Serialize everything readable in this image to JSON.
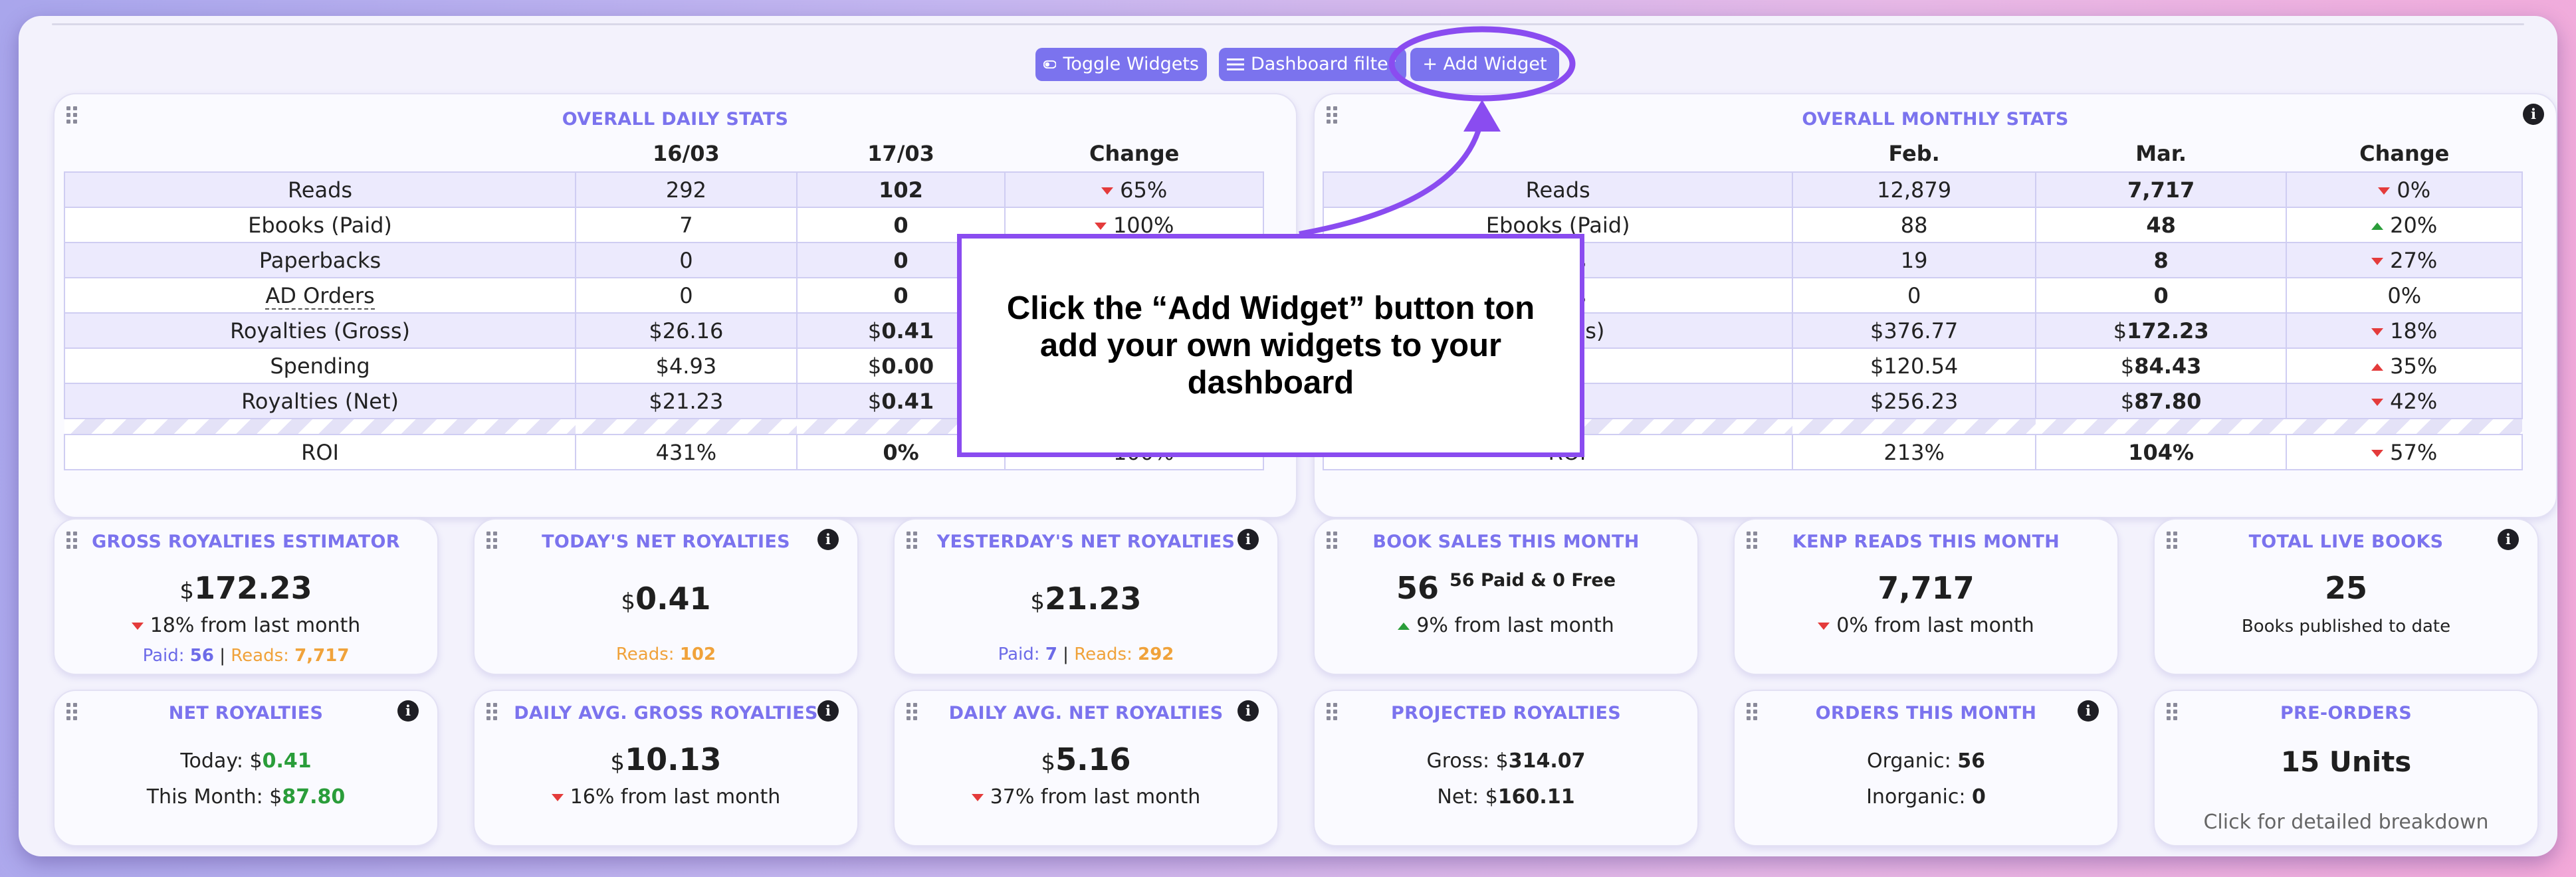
{
  "toolbar": {
    "toggle_widgets": "Toggle Widgets",
    "dashboard_filter": "Dashboard filter",
    "add_widget": "+ Add Widget"
  },
  "daily": {
    "title": "OVERALL DAILY STATS",
    "headers": [
      "",
      "16/03",
      "17/03",
      "Change"
    ],
    "rows": [
      {
        "label": "Reads",
        "a": "292",
        "b": "102",
        "change": "65%",
        "dir": "down"
      },
      {
        "label": "Ebooks (Paid)",
        "a": "7",
        "b": "0",
        "change": "100%",
        "dir": "down"
      },
      {
        "label": "Paperbacks",
        "a": "0",
        "b": "0",
        "change": "",
        "dir": ""
      },
      {
        "label": "AD Orders",
        "a": "0",
        "b": "0",
        "change": "",
        "dir": ""
      },
      {
        "label": "Royalties (Gross)",
        "a": "$26.16",
        "b": "0.41",
        "change": "",
        "dir": ""
      },
      {
        "label": "Spending",
        "a": "$4.93",
        "b": "0.00",
        "change": "",
        "dir": ""
      },
      {
        "label": "Royalties (Net)",
        "a": "$21.23",
        "b": "0.41",
        "change": "",
        "dir": ""
      }
    ],
    "roi": {
      "label": "ROI",
      "a": "431%",
      "b": "0%",
      "change": "100%",
      "dir": "down"
    }
  },
  "monthly": {
    "title": "OVERALL MONTHLY STATS",
    "headers": [
      "",
      "Feb.",
      "Mar.",
      "Change"
    ],
    "rows": [
      {
        "label": "Reads",
        "a": "12,879",
        "b": "7,717",
        "change": "0%",
        "dir": "down"
      },
      {
        "label": "Ebooks (Paid)",
        "a": "88",
        "b": "48",
        "change": "20%",
        "dir": "up"
      },
      {
        "label": "cks",
        "a": "19",
        "b": "8",
        "change": "27%",
        "dir": "down"
      },
      {
        "label": "ers",
        "a": "0",
        "b": "0",
        "change": "0%",
        "dir": ""
      },
      {
        "label": "Gross)",
        "a": "$376.77",
        "b": "172.23",
        "change": "18%",
        "dir": "down"
      },
      {
        "label": "g",
        "a": "$120.54",
        "b": "84.43",
        "change": "35%",
        "dir": "up"
      },
      {
        "label": "Net)",
        "a": "$256.23",
        "b": "87.80",
        "change": "42%",
        "dir": "down"
      }
    ],
    "roi": {
      "label": "ROI",
      "a": "213%",
      "b": "104%",
      "change": "57%",
      "dir": "down"
    }
  },
  "cards": {
    "gross_estimator": {
      "title": "GROSS ROYALTIES ESTIMATOR",
      "value": "172.23",
      "change": "18% from last month",
      "paid_label": "Paid:",
      "paid": "56",
      "reads_label": "Reads:",
      "reads": "7,717"
    },
    "todays_net": {
      "title": "TODAY'S NET ROYALTIES",
      "value": "0.41",
      "reads_label": "Reads:",
      "reads": "102"
    },
    "yesterdays_net": {
      "title": "YESTERDAY'S NET ROYALTIES",
      "value": "21.23",
      "paid_label": "Paid:",
      "paid": "7",
      "reads_label": "Reads:",
      "reads": "292"
    },
    "book_sales": {
      "title": "BOOK SALES THIS MONTH",
      "value": "56",
      "detail": "56 Paid & 0 Free",
      "change": "9% from last month"
    },
    "kenp": {
      "title": "KENP READS THIS MONTH",
      "value": "7,717",
      "change": "0% from last month"
    },
    "live_books": {
      "title": "TOTAL LIVE BOOKS",
      "value": "25",
      "caption": "Books published to date"
    },
    "net_royalties": {
      "title": "NET ROYALTIES",
      "today_label": "Today:",
      "today": "0.41",
      "month_label": "This Month:",
      "month": "87.80"
    },
    "daily_avg_gross": {
      "title": "DAILY AVG. GROSS ROYALTIES",
      "value": "10.13",
      "change": "16% from last month"
    },
    "daily_avg_net": {
      "title": "DAILY AVG. NET ROYALTIES",
      "value": "5.16",
      "change": "37% from last month"
    },
    "projected": {
      "title": "PROJECTED ROYALTIES",
      "gross_label": "Gross:",
      "gross": "314.07",
      "net_label": "Net:",
      "net": "160.11"
    },
    "orders": {
      "title": "ORDERS THIS MONTH",
      "organic_label": "Organic:",
      "organic": "56",
      "inorganic_label": "Inorganic:",
      "inorganic": "0"
    },
    "preorders": {
      "title": "PRE-ORDERS",
      "value": "15 Units",
      "caption": "Click for detailed breakdown"
    }
  },
  "currency": "$",
  "callout": {
    "text": "Click the “Add Widget” button ton add your own widgets to your dashboard"
  },
  "colors": {
    "accent": "#7b73ee",
    "annotation": "#8a4cf0",
    "down": "#e43b3b",
    "up": "#2a9d3a",
    "orange": "#f0a23a"
  }
}
